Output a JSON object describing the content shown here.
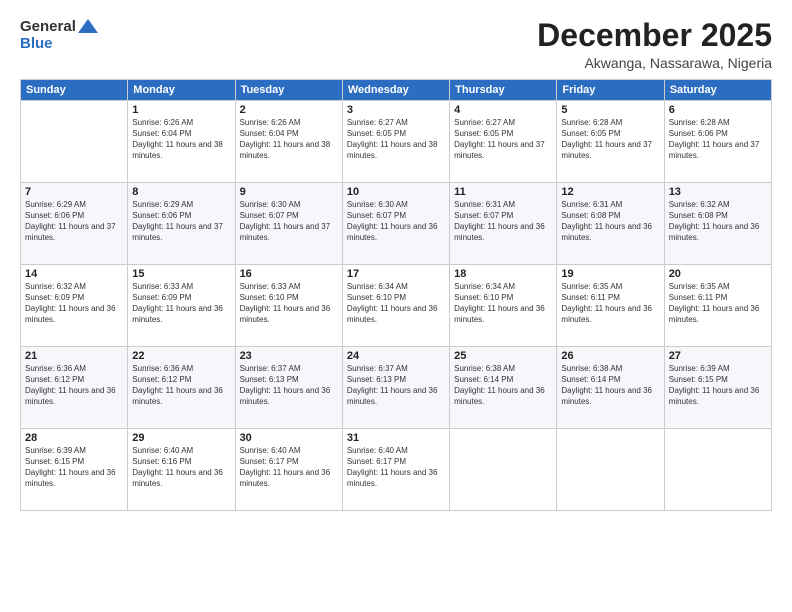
{
  "logo": {
    "general": "General",
    "blue": "Blue"
  },
  "title": {
    "month": "December 2025",
    "location": "Akwanga, Nassarawa, Nigeria"
  },
  "headers": [
    "Sunday",
    "Monday",
    "Tuesday",
    "Wednesday",
    "Thursday",
    "Friday",
    "Saturday"
  ],
  "weeks": [
    [
      {
        "day": "",
        "sunrise": "",
        "sunset": "",
        "daylight": ""
      },
      {
        "day": "1",
        "sunrise": "Sunrise: 6:26 AM",
        "sunset": "Sunset: 6:04 PM",
        "daylight": "Daylight: 11 hours and 38 minutes."
      },
      {
        "day": "2",
        "sunrise": "Sunrise: 6:26 AM",
        "sunset": "Sunset: 6:04 PM",
        "daylight": "Daylight: 11 hours and 38 minutes."
      },
      {
        "day": "3",
        "sunrise": "Sunrise: 6:27 AM",
        "sunset": "Sunset: 6:05 PM",
        "daylight": "Daylight: 11 hours and 38 minutes."
      },
      {
        "day": "4",
        "sunrise": "Sunrise: 6:27 AM",
        "sunset": "Sunset: 6:05 PM",
        "daylight": "Daylight: 11 hours and 37 minutes."
      },
      {
        "day": "5",
        "sunrise": "Sunrise: 6:28 AM",
        "sunset": "Sunset: 6:05 PM",
        "daylight": "Daylight: 11 hours and 37 minutes."
      },
      {
        "day": "6",
        "sunrise": "Sunrise: 6:28 AM",
        "sunset": "Sunset: 6:06 PM",
        "daylight": "Daylight: 11 hours and 37 minutes."
      }
    ],
    [
      {
        "day": "7",
        "sunrise": "Sunrise: 6:29 AM",
        "sunset": "Sunset: 6:06 PM",
        "daylight": "Daylight: 11 hours and 37 minutes."
      },
      {
        "day": "8",
        "sunrise": "Sunrise: 6:29 AM",
        "sunset": "Sunset: 6:06 PM",
        "daylight": "Daylight: 11 hours and 37 minutes."
      },
      {
        "day": "9",
        "sunrise": "Sunrise: 6:30 AM",
        "sunset": "Sunset: 6:07 PM",
        "daylight": "Daylight: 11 hours and 37 minutes."
      },
      {
        "day": "10",
        "sunrise": "Sunrise: 6:30 AM",
        "sunset": "Sunset: 6:07 PM",
        "daylight": "Daylight: 11 hours and 36 minutes."
      },
      {
        "day": "11",
        "sunrise": "Sunrise: 6:31 AM",
        "sunset": "Sunset: 6:07 PM",
        "daylight": "Daylight: 11 hours and 36 minutes."
      },
      {
        "day": "12",
        "sunrise": "Sunrise: 6:31 AM",
        "sunset": "Sunset: 6:08 PM",
        "daylight": "Daylight: 11 hours and 36 minutes."
      },
      {
        "day": "13",
        "sunrise": "Sunrise: 6:32 AM",
        "sunset": "Sunset: 6:08 PM",
        "daylight": "Daylight: 11 hours and 36 minutes."
      }
    ],
    [
      {
        "day": "14",
        "sunrise": "Sunrise: 6:32 AM",
        "sunset": "Sunset: 6:09 PM",
        "daylight": "Daylight: 11 hours and 36 minutes."
      },
      {
        "day": "15",
        "sunrise": "Sunrise: 6:33 AM",
        "sunset": "Sunset: 6:09 PM",
        "daylight": "Daylight: 11 hours and 36 minutes."
      },
      {
        "day": "16",
        "sunrise": "Sunrise: 6:33 AM",
        "sunset": "Sunset: 6:10 PM",
        "daylight": "Daylight: 11 hours and 36 minutes."
      },
      {
        "day": "17",
        "sunrise": "Sunrise: 6:34 AM",
        "sunset": "Sunset: 6:10 PM",
        "daylight": "Daylight: 11 hours and 36 minutes."
      },
      {
        "day": "18",
        "sunrise": "Sunrise: 6:34 AM",
        "sunset": "Sunset: 6:10 PM",
        "daylight": "Daylight: 11 hours and 36 minutes."
      },
      {
        "day": "19",
        "sunrise": "Sunrise: 6:35 AM",
        "sunset": "Sunset: 6:11 PM",
        "daylight": "Daylight: 11 hours and 36 minutes."
      },
      {
        "day": "20",
        "sunrise": "Sunrise: 6:35 AM",
        "sunset": "Sunset: 6:11 PM",
        "daylight": "Daylight: 11 hours and 36 minutes."
      }
    ],
    [
      {
        "day": "21",
        "sunrise": "Sunrise: 6:36 AM",
        "sunset": "Sunset: 6:12 PM",
        "daylight": "Daylight: 11 hours and 36 minutes."
      },
      {
        "day": "22",
        "sunrise": "Sunrise: 6:36 AM",
        "sunset": "Sunset: 6:12 PM",
        "daylight": "Daylight: 11 hours and 36 minutes."
      },
      {
        "day": "23",
        "sunrise": "Sunrise: 6:37 AM",
        "sunset": "Sunset: 6:13 PM",
        "daylight": "Daylight: 11 hours and 36 minutes."
      },
      {
        "day": "24",
        "sunrise": "Sunrise: 6:37 AM",
        "sunset": "Sunset: 6:13 PM",
        "daylight": "Daylight: 11 hours and 36 minutes."
      },
      {
        "day": "25",
        "sunrise": "Sunrise: 6:38 AM",
        "sunset": "Sunset: 6:14 PM",
        "daylight": "Daylight: 11 hours and 36 minutes."
      },
      {
        "day": "26",
        "sunrise": "Sunrise: 6:38 AM",
        "sunset": "Sunset: 6:14 PM",
        "daylight": "Daylight: 11 hours and 36 minutes."
      },
      {
        "day": "27",
        "sunrise": "Sunrise: 6:39 AM",
        "sunset": "Sunset: 6:15 PM",
        "daylight": "Daylight: 11 hours and 36 minutes."
      }
    ],
    [
      {
        "day": "28",
        "sunrise": "Sunrise: 6:39 AM",
        "sunset": "Sunset: 6:15 PM",
        "daylight": "Daylight: 11 hours and 36 minutes."
      },
      {
        "day": "29",
        "sunrise": "Sunrise: 6:40 AM",
        "sunset": "Sunset: 6:16 PM",
        "daylight": "Daylight: 11 hours and 36 minutes."
      },
      {
        "day": "30",
        "sunrise": "Sunrise: 6:40 AM",
        "sunset": "Sunset: 6:17 PM",
        "daylight": "Daylight: 11 hours and 36 minutes."
      },
      {
        "day": "31",
        "sunrise": "Sunrise: 6:40 AM",
        "sunset": "Sunset: 6:17 PM",
        "daylight": "Daylight: 11 hours and 36 minutes."
      },
      {
        "day": "",
        "sunrise": "",
        "sunset": "",
        "daylight": ""
      },
      {
        "day": "",
        "sunrise": "",
        "sunset": "",
        "daylight": ""
      },
      {
        "day": "",
        "sunrise": "",
        "sunset": "",
        "daylight": ""
      }
    ]
  ]
}
